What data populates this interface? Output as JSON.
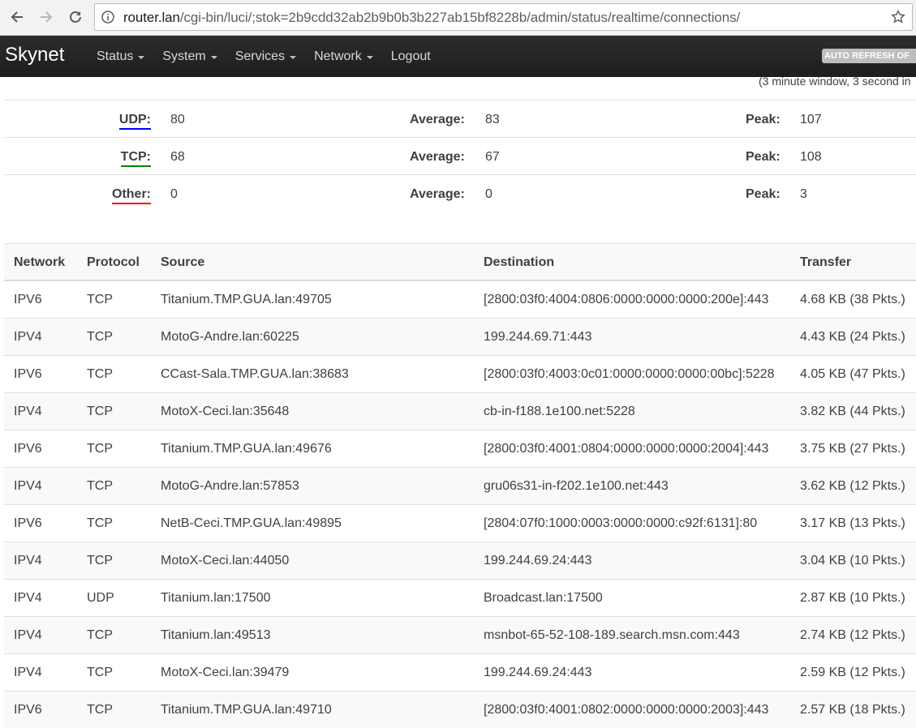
{
  "browser": {
    "url_host": "router.lan",
    "url_rest": "/cgi-bin/luci/;stok=2b9cdd32ab2b9b0b3b227ab15bf8228b/admin/status/realtime/connections/"
  },
  "header": {
    "brand": "Skynet",
    "menu": [
      {
        "label": "Status",
        "dropdown": true
      },
      {
        "label": "System",
        "dropdown": true
      },
      {
        "label": "Services",
        "dropdown": true
      },
      {
        "label": "Network",
        "dropdown": true
      },
      {
        "label": "Logout",
        "dropdown": false
      }
    ],
    "auto_refresh": "AUTO REFRESH OF"
  },
  "window_note": "(3 minute window, 3 second in",
  "summary": [
    {
      "label": "UDP:",
      "color": "#0000ff",
      "value": "80",
      "avg_label": "Average:",
      "avg": "83",
      "peak_label": "Peak:",
      "peak": "107"
    },
    {
      "label": "TCP:",
      "color": "#008000",
      "value": "68",
      "avg_label": "Average:",
      "avg": "67",
      "peak_label": "Peak:",
      "peak": "108"
    },
    {
      "label": "Other:",
      "color": "#ff0000",
      "value": "0",
      "avg_label": "Average:",
      "avg": "0",
      "peak_label": "Peak:",
      "peak": "3"
    }
  ],
  "table": {
    "headers": [
      "Network",
      "Protocol",
      "Source",
      "Destination",
      "Transfer"
    ],
    "rows": [
      [
        "IPV6",
        "TCP",
        "Titanium.TMP.GUA.lan:49705",
        "[2800:03f0:4004:0806:0000:0000:0000:200e]:443",
        "4.68 KB (38 Pkts.)"
      ],
      [
        "IPV4",
        "TCP",
        "MotoG-Andre.lan:60225",
        "199.244.69.71:443",
        "4.43 KB (24 Pkts.)"
      ],
      [
        "IPV6",
        "TCP",
        "CCast-Sala.TMP.GUA.lan:38683",
        "[2800:03f0:4003:0c01:0000:0000:0000:00bc]:5228",
        "4.05 KB (47 Pkts.)"
      ],
      [
        "IPV4",
        "TCP",
        "MotoX-Ceci.lan:35648",
        "cb-in-f188.1e100.net:5228",
        "3.82 KB (44 Pkts.)"
      ],
      [
        "IPV6",
        "TCP",
        "Titanium.TMP.GUA.lan:49676",
        "[2800:03f0:4001:0804:0000:0000:0000:2004]:443",
        "3.75 KB (27 Pkts.)"
      ],
      [
        "IPV4",
        "TCP",
        "MotoG-Andre.lan:57853",
        "gru06s31-in-f202.1e100.net:443",
        "3.62 KB (12 Pkts.)"
      ],
      [
        "IPV6",
        "TCP",
        "NetB-Ceci.TMP.GUA.lan:49895",
        "[2804:07f0:1000:0003:0000:0000:c92f:6131]:80",
        "3.17 KB (13 Pkts.)"
      ],
      [
        "IPV4",
        "TCP",
        "MotoX-Ceci.lan:44050",
        "199.244.69.24:443",
        "3.04 KB (10 Pkts.)"
      ],
      [
        "IPV4",
        "UDP",
        "Titanium.lan:17500",
        "Broadcast.lan:17500",
        "2.87 KB (10 Pkts.)"
      ],
      [
        "IPV4",
        "TCP",
        "Titanium.lan:49513",
        "msnbot-65-52-108-189.search.msn.com:443",
        "2.74 KB (12 Pkts.)"
      ],
      [
        "IPV4",
        "TCP",
        "MotoX-Ceci.lan:39479",
        "199.244.69.24:443",
        "2.59 KB (12 Pkts.)"
      ],
      [
        "IPV6",
        "TCP",
        "Titanium.TMP.GUA.lan:49710",
        "[2800:03f0:4001:0802:0000:0000:0000:2003]:443",
        "2.57 KB (18 Pkts.)"
      ]
    ]
  }
}
